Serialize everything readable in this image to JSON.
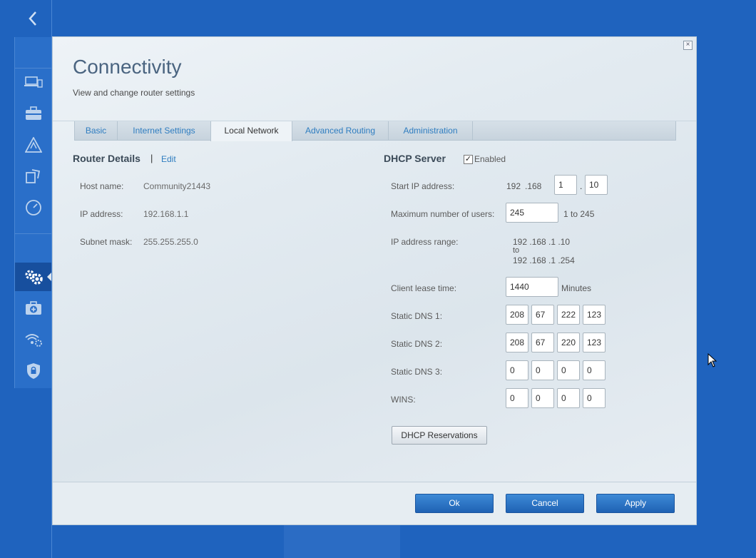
{
  "rail": {
    "back_icon": "chevron-left-icon",
    "icons": [
      "devices-icon",
      "toolbox-icon",
      "alert-icon",
      "parental-icon",
      "speedometer-icon",
      "settings-gears-icon",
      "medical-kit-icon",
      "wireless-settings-icon",
      "security-shield-icon"
    ],
    "active": "settings-gears-icon"
  },
  "dialog": {
    "title": "Connectivity",
    "subtitle": "View and change router settings",
    "close_symbol": "×"
  },
  "tabs": [
    {
      "label": "Basic",
      "active": false
    },
    {
      "label": "Internet Settings",
      "active": false
    },
    {
      "label": "Local Network",
      "active": true
    },
    {
      "label": "Advanced Routing",
      "active": false
    },
    {
      "label": "Administration",
      "active": false
    }
  ],
  "router_details": {
    "title": "Router Details",
    "separator": "|",
    "edit_label": "Edit",
    "host_name_label": "Host name:",
    "host_name": "Community21443",
    "ip_label": "IP address:",
    "ip": "192.168.1.1",
    "subnet_label": "Subnet mask:",
    "subnet": "255.255.255.0"
  },
  "dhcp": {
    "title": "DHCP Server",
    "enabled_checked": true,
    "enabled_label": "Enabled",
    "start_ip_label": "Start IP address:",
    "start_ip_fixed_1": "192",
    "start_ip_fixed_2": ".168",
    "start_ip_octet3": "1",
    "start_ip_octet4": "10",
    "max_users_label": "Maximum number of users:",
    "max_users": "245",
    "max_users_range": "1 to 245",
    "ip_range_label": "IP address range:",
    "ip_range_start": "192 .168 .1 .10",
    "ip_range_to": "to",
    "ip_range_end": "192 .168 .1 .254",
    "lease_label": "Client lease time:",
    "lease_value": "1440",
    "lease_unit": "Minutes",
    "dns1_label": "Static DNS 1:",
    "dns1": [
      "208",
      "67",
      "222",
      "123"
    ],
    "dns2_label": "Static DNS 2:",
    "dns2": [
      "208",
      "67",
      "220",
      "123"
    ],
    "dns3_label": "Static DNS 3:",
    "dns3": [
      "0",
      "0",
      "0",
      "0"
    ],
    "wins_label": "WINS:",
    "wins": [
      "0",
      "0",
      "0",
      "0"
    ],
    "reservations_label": "DHCP Reservations"
  },
  "footer": {
    "ok_label": "Ok",
    "cancel_label": "Cancel",
    "apply_label": "Apply"
  }
}
